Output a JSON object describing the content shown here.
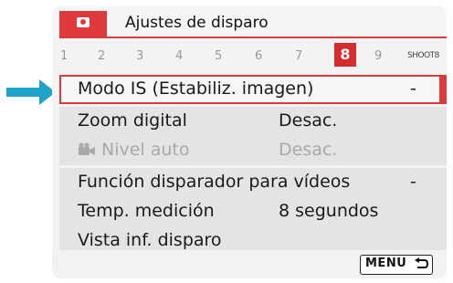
{
  "header": {
    "title": "Ajustes de disparo",
    "camera_icon": "camera-icon"
  },
  "tabs": {
    "items": [
      "1",
      "2",
      "3",
      "4",
      "5",
      "6",
      "7",
      "8",
      "9"
    ],
    "selected": "8",
    "shoot_label": "SHOOT8"
  },
  "menu": {
    "items": [
      {
        "label": "Modo IS (Estabiliz. imagen)",
        "value": "-",
        "selected": true,
        "disabled": false
      },
      {
        "label": "Zoom digital",
        "value": "Desac.",
        "selected": false,
        "disabled": false
      },
      {
        "label": "Nivel auto",
        "value": "Desac.",
        "selected": false,
        "disabled": true,
        "icon": "movie-camera-icon"
      },
      {
        "label": "Función disparador para vídeos",
        "value": "-",
        "selected": false,
        "disabled": false
      },
      {
        "label": "Temp. medición",
        "value": "8 segundos",
        "selected": false,
        "disabled": false
      },
      {
        "label": "Vista inf. disparo",
        "value": "",
        "selected": false,
        "disabled": false
      }
    ]
  },
  "footer": {
    "menu_button": "MENU",
    "return_icon": "return-arrow-icon"
  },
  "colors": {
    "accent": "#e0393c",
    "pointer": "#1fa3c9",
    "row_bg": "#e4e4e4",
    "disabled_text": "#a9a9a9"
  }
}
